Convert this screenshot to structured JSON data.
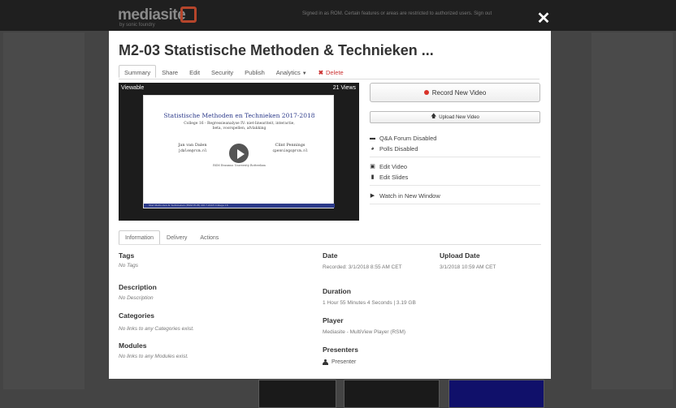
{
  "background": {
    "logo": "mediasite",
    "logo_sub": "by sonic foundry",
    "notice": "Signed in as ROM. Certain features or areas are restricted to authorized users. Sign out"
  },
  "modal": {
    "title": "M2-03 Statistische Methoden & Technieken ...",
    "tabs": [
      {
        "label": "Summary",
        "active": true
      },
      {
        "label": "Share"
      },
      {
        "label": "Edit"
      },
      {
        "label": "Security"
      },
      {
        "label": "Publish"
      },
      {
        "label": "Analytics",
        "caret": "▼"
      },
      {
        "label": "Delete",
        "icon": "✖"
      }
    ],
    "close_glyph": "✕"
  },
  "video": {
    "status": "Viewable",
    "views": "21 Views",
    "slide": {
      "title": "Statistische Methoden en Technieken 2017-2018",
      "subtitle_line1": "College 16 - Regressieanalyse IV: niet-lineariteit, interactie,",
      "subtitle_line2": "beta, voorspellen, afvlakking",
      "author1_name": "Jan van Dalen",
      "author1_email": "jdalen@rsm.nl",
      "author2_name": "Clint Pennings",
      "author2_email": "cpennings@rsm.nl",
      "institution": "RSM Erasmus University Rotterdam",
      "footer": "Stat Methoden & Technieken (RSM EUR)      2017-2018 College 16"
    }
  },
  "actions": {
    "record": "Record New Video",
    "upload": "Upload New Video",
    "qa_forum": "Q&A Forum Disabled",
    "polls": "Polls Disabled",
    "edit_video": "Edit Video",
    "edit_slides": "Edit Slides",
    "watch_new_window": "Watch in New Window"
  },
  "info_tabs": [
    {
      "label": "Information",
      "active": true
    },
    {
      "label": "Delivery"
    },
    {
      "label": "Actions"
    }
  ],
  "info": {
    "tags_label": "Tags",
    "tags_value": "No Tags",
    "description_label": "Description",
    "description_value": "No Description",
    "categories_label": "Categories",
    "categories_value": "No links to any Categories exist.",
    "modules_label": "Modules",
    "modules_value": "No links to any Modules exist.",
    "date_label": "Date",
    "date_value": "Recorded: 3/1/2018 8:55 AM CET",
    "upload_date_label": "Upload Date",
    "upload_date_value": "3/1/2018 10:59 AM CET",
    "duration_label": "Duration",
    "duration_value": "1 Hour 55 Minutes 4 Seconds | 3.19 GB",
    "player_label": "Player",
    "player_value": "Mediasite - MultiView Player (RSM)",
    "presenters_label": "Presenters",
    "presenters_value": "Presenter"
  },
  "colors": {
    "record_dot": "#d9332a",
    "delete": "#cc3333",
    "slide_title": "#2c3a8a"
  }
}
